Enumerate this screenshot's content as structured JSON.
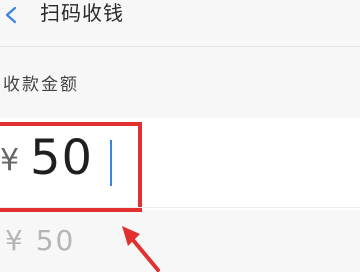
{
  "header": {
    "title": "扫码收钱",
    "back_icon": "chevron-left-icon"
  },
  "form": {
    "label": "收款金额",
    "currency_symbol": "¥",
    "amount": "50",
    "preview": "¥ 50"
  },
  "colors": {
    "accent_blue": "#3a83e0",
    "annotation_red": "#e23030",
    "background": "#f7f7f7"
  }
}
